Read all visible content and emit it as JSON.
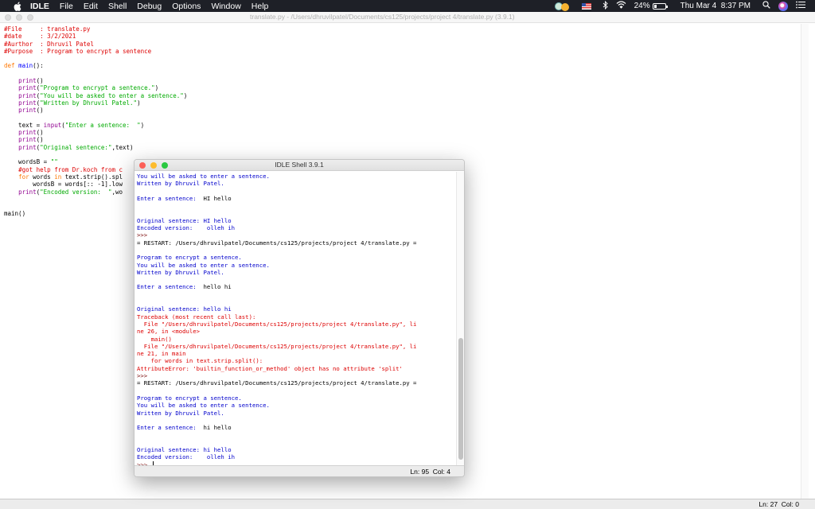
{
  "menubar": {
    "apple": "",
    "app_name": "IDLE",
    "items": [
      "File",
      "Edit",
      "Shell",
      "Debug",
      "Options",
      "Window",
      "Help"
    ],
    "battery_percent": "24%",
    "battery_level": 0.24,
    "clock": "Thu Mar 4  8:37 PM",
    "icons": [
      "creative-cloud-icon",
      "flag-us-icon",
      "bluetooth-icon",
      "wifi-icon",
      "battery-icon",
      "spotlight-search-icon",
      "siri-icon",
      "notification-center-icon"
    ]
  },
  "editor": {
    "title": "translate.py - /Users/dhruvilpatel/Documents/cs125/projects/project 4/translate.py (3.9.1)",
    "status": "Ln: 27  Col: 0",
    "lines": [
      [
        {
          "t": "#File     : translate.py",
          "c": "comment"
        }
      ],
      [
        {
          "t": "#date     : 3/2/2021",
          "c": "comment"
        }
      ],
      [
        {
          "t": "#Aurthor  : Dhruvil Patel",
          "c": "comment"
        }
      ],
      [
        {
          "t": "#Purpose  : Program to encrypt a sentence",
          "c": "comment"
        }
      ],
      [],
      [
        {
          "t": "def",
          "c": "kw"
        },
        {
          "t": " "
        },
        {
          "t": "main",
          "c": "def"
        },
        {
          "t": "():"
        }
      ],
      [],
      [
        {
          "t": "    "
        },
        {
          "t": "print",
          "c": "builtin"
        },
        {
          "t": "()"
        }
      ],
      [
        {
          "t": "    "
        },
        {
          "t": "print",
          "c": "builtin"
        },
        {
          "t": "("
        },
        {
          "t": "\"Program to encrypt a sentence.\"",
          "c": "str"
        },
        {
          "t": ")"
        }
      ],
      [
        {
          "t": "    "
        },
        {
          "t": "print",
          "c": "builtin"
        },
        {
          "t": "("
        },
        {
          "t": "\"You will be asked to enter a sentence.\"",
          "c": "str"
        },
        {
          "t": ")"
        }
      ],
      [
        {
          "t": "    "
        },
        {
          "t": "print",
          "c": "builtin"
        },
        {
          "t": "("
        },
        {
          "t": "\"Written by Dhruvil Patel.\"",
          "c": "str"
        },
        {
          "t": ")"
        }
      ],
      [
        {
          "t": "    "
        },
        {
          "t": "print",
          "c": "builtin"
        },
        {
          "t": "()"
        }
      ],
      [],
      [
        {
          "t": "    text = "
        },
        {
          "t": "input",
          "c": "builtin"
        },
        {
          "t": "("
        },
        {
          "t": "\"Enter a sentence:  \"",
          "c": "str"
        },
        {
          "t": ")"
        }
      ],
      [
        {
          "t": "    "
        },
        {
          "t": "print",
          "c": "builtin"
        },
        {
          "t": "()"
        }
      ],
      [
        {
          "t": "    "
        },
        {
          "t": "print",
          "c": "builtin"
        },
        {
          "t": "()"
        }
      ],
      [
        {
          "t": "    "
        },
        {
          "t": "print",
          "c": "builtin"
        },
        {
          "t": "("
        },
        {
          "t": "\"Original sentence:\"",
          "c": "str"
        },
        {
          "t": ",text)"
        }
      ],
      [],
      [
        {
          "t": "    wordsB = "
        },
        {
          "t": "\"\"",
          "c": "str"
        }
      ],
      [
        {
          "t": "    "
        },
        {
          "t": "#got help from Dr.koch from c",
          "c": "comment"
        }
      ],
      [
        {
          "t": "    "
        },
        {
          "t": "for",
          "c": "kw"
        },
        {
          "t": " words "
        },
        {
          "t": "in",
          "c": "kw"
        },
        {
          "t": " text.strip().spl"
        }
      ],
      [
        {
          "t": "        wordsB = words[:: -1].low"
        }
      ],
      [
        {
          "t": "    "
        },
        {
          "t": "print",
          "c": "builtin"
        },
        {
          "t": "("
        },
        {
          "t": "\"Encoded version:  \"",
          "c": "str"
        },
        {
          "t": ",wo"
        }
      ],
      [],
      [],
      [
        {
          "t": "main()"
        }
      ]
    ]
  },
  "shell": {
    "title": "IDLE Shell 3.9.1",
    "status": "Ln: 95  Col: 4",
    "scroll_thumb_start": 0.57,
    "scroll_thumb_end": 0.99,
    "lines": [
      [
        {
          "t": "You will be asked to enter a sentence.",
          "c": "out"
        }
      ],
      [
        {
          "t": "Written by Dhruvil Patel.",
          "c": "out"
        }
      ],
      [],
      [
        {
          "t": "Enter a sentence:  ",
          "c": "out"
        },
        {
          "t": "HI hello",
          "c": "in"
        }
      ],
      [],
      [],
      [
        {
          "t": "Original sentence: HI hello",
          "c": "out"
        }
      ],
      [
        {
          "t": "Encoded version:    olleh ih",
          "c": "out"
        }
      ],
      [
        {
          "t": ">>> ",
          "c": "prompt"
        }
      ],
      [
        {
          "t": "= RESTART: /Users/dhruvilpatel/Documents/cs125/projects/project 4/translate.py =",
          "c": "in"
        }
      ],
      [],
      [
        {
          "t": "Program to encrypt a sentence.",
          "c": "out"
        }
      ],
      [
        {
          "t": "You will be asked to enter a sentence.",
          "c": "out"
        }
      ],
      [
        {
          "t": "Written by Dhruvil Patel.",
          "c": "out"
        }
      ],
      [],
      [
        {
          "t": "Enter a sentence:  ",
          "c": "out"
        },
        {
          "t": "hello hi",
          "c": "in"
        }
      ],
      [],
      [],
      [
        {
          "t": "Original sentence: hello hi",
          "c": "out"
        }
      ],
      [
        {
          "t": "Traceback (most recent call last):",
          "c": "err"
        }
      ],
      [
        {
          "t": "  File \"/Users/dhruvilpatel/Documents/cs125/projects/project 4/translate.py\", li",
          "c": "err"
        }
      ],
      [
        {
          "t": "ne 26, in <module>",
          "c": "err"
        }
      ],
      [
        {
          "t": "    main()",
          "c": "err"
        }
      ],
      [
        {
          "t": "  File \"/Users/dhruvilpatel/Documents/cs125/projects/project 4/translate.py\", li",
          "c": "err"
        }
      ],
      [
        {
          "t": "ne 21, in main",
          "c": "err"
        }
      ],
      [
        {
          "t": "    for words in text.strip.split():",
          "c": "err"
        }
      ],
      [
        {
          "t": "AttributeError: 'builtin_function_or_method' object has no attribute 'split'",
          "c": "err"
        }
      ],
      [
        {
          "t": ">>> ",
          "c": "prompt"
        }
      ],
      [
        {
          "t": "= RESTART: /Users/dhruvilpatel/Documents/cs125/projects/project 4/translate.py =",
          "c": "in"
        }
      ],
      [],
      [
        {
          "t": "Program to encrypt a sentence.",
          "c": "out"
        }
      ],
      [
        {
          "t": "You will be asked to enter a sentence.",
          "c": "out"
        }
      ],
      [
        {
          "t": "Written by Dhruvil Patel.",
          "c": "out"
        }
      ],
      [],
      [
        {
          "t": "Enter a sentence:  ",
          "c": "out"
        },
        {
          "t": "hi hello",
          "c": "in"
        }
      ],
      [],
      [],
      [
        {
          "t": "Original sentence: hi hello",
          "c": "out"
        }
      ],
      [
        {
          "t": "Encoded version:    olleh ih",
          "c": "out"
        }
      ],
      [
        {
          "t": ">>> ",
          "c": "prompt"
        },
        {
          "t": "",
          "c": "caret"
        }
      ]
    ]
  }
}
